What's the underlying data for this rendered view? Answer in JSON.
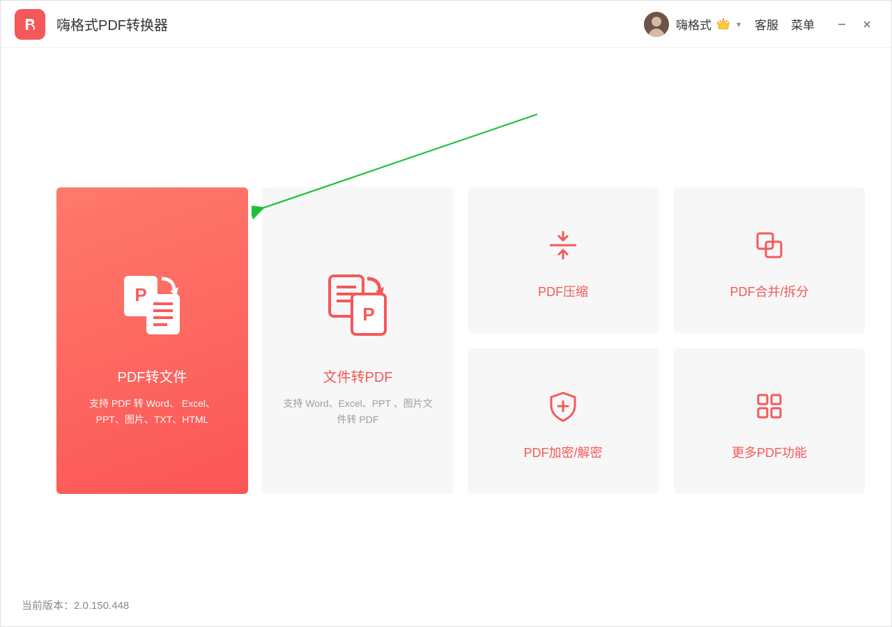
{
  "header": {
    "app_title": "嗨格式PDF转换器",
    "username": "嗨格式",
    "nav_customer_service": "客服",
    "nav_menu": "菜单"
  },
  "cards": {
    "pdf_to_file": {
      "title": "PDF转文件",
      "desc": "支持 PDF 转 Word、 Excel、PPT、图片、TXT、HTML"
    },
    "file_to_pdf": {
      "title": "文件转PDF",
      "desc": "支持 Word、Excel、PPT 、图片文件转 PDF"
    },
    "compress": {
      "title": "PDF压缩"
    },
    "merge_split": {
      "title": "PDF合并/拆分"
    },
    "encrypt": {
      "title": "PDF加密/解密"
    },
    "more": {
      "title": "更多PDF功能"
    }
  },
  "footer": {
    "version_label": "当前版本：",
    "version_value": "2.0.150.448"
  },
  "colors": {
    "accent": "#f55858",
    "card_bg": "#f7f7f7",
    "arrow": "#1fbf3c"
  }
}
